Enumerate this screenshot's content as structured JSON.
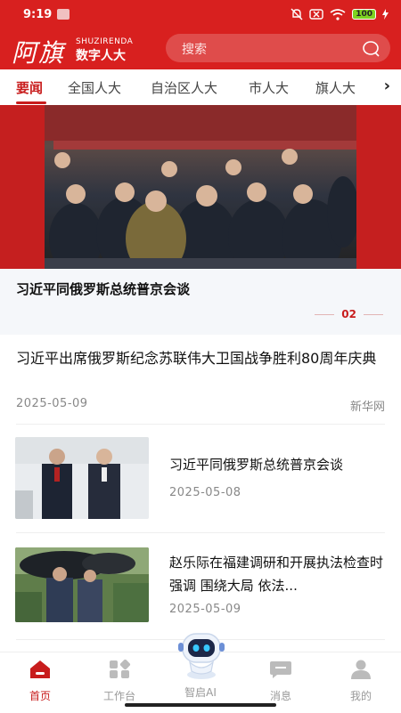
{
  "status_bar": {
    "time": "9:19",
    "battery": "100"
  },
  "header": {
    "logo_cn": "阿旗",
    "logo_en": "SHUZIRENDA",
    "logo_sub": "数字人大",
    "search_placeholder": "搜索"
  },
  "tabs": [
    {
      "label": "要闻",
      "active": true
    },
    {
      "label": "全国人大"
    },
    {
      "label": "自治区人大"
    },
    {
      "label": "市人大"
    },
    {
      "label": "旗人大"
    }
  ],
  "banner": {
    "title": "习近平同俄罗斯总统普京会谈",
    "page": "02"
  },
  "lead_article": {
    "title": "习近平出席俄罗斯纪念苏联伟大卫国战争胜利80周年庆典",
    "date": "2025-05-09",
    "source": "新华网"
  },
  "news": [
    {
      "title": "习近平同俄罗斯总统普京会谈",
      "date": "2025-05-08"
    },
    {
      "title": "赵乐际在福建调研和开展执法检查时强调 围绕大局 依法...",
      "date": "2025-05-09"
    }
  ],
  "bottom_nav": [
    {
      "label": "首页",
      "icon": "home-icon",
      "active": true
    },
    {
      "label": "工作台",
      "icon": "grid-icon"
    },
    {
      "label": "智启AI",
      "icon": "robot-icon"
    },
    {
      "label": "消息",
      "icon": "chat-icon"
    },
    {
      "label": "我的",
      "icon": "user-icon"
    }
  ],
  "colors": {
    "brand_red": "#d8201f",
    "accent_red": "#c81d1d"
  }
}
